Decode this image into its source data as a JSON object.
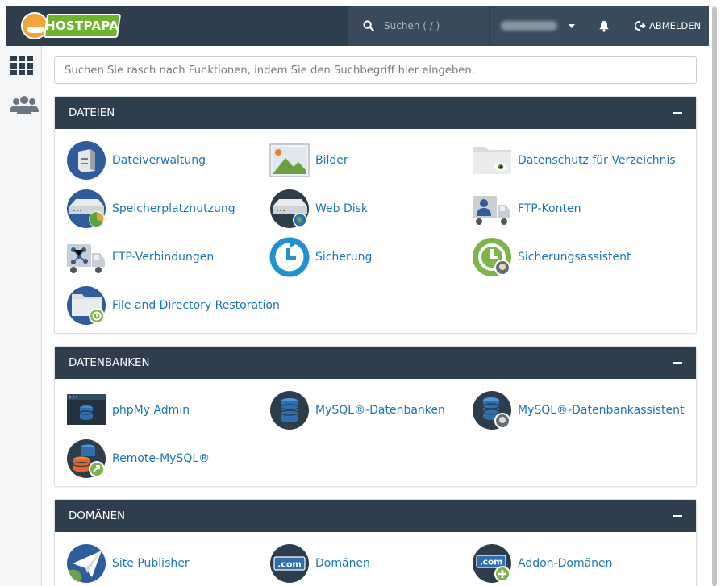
{
  "header": {
    "logo_text": "HOSTPAPA",
    "search_placeholder": "Suchen ( / )",
    "logout_label": "ABMELDEN",
    "colors": {
      "bar": "#2f3e4d",
      "segment": "#394a5b",
      "logo_green": "#6fb42c"
    }
  },
  "sidebar": {
    "items": [
      {
        "name": "apps-grid-icon"
      },
      {
        "name": "users-icon"
      }
    ]
  },
  "main": {
    "search_placeholder": "Suchen Sie rasch nach Funktionen, indem Sie den Suchbegriff hier eingeben.",
    "link_color": "#1b76b6",
    "sections": [
      {
        "title": "DATEIEN",
        "items": [
          {
            "label": "Dateiverwaltung",
            "icon": "file-manager-icon"
          },
          {
            "label": "Bilder",
            "icon": "images-icon"
          },
          {
            "label": "Datenschutz für Verzeichnis",
            "icon": "directory-privacy-icon"
          },
          {
            "label": "Speicherplatznutzung",
            "icon": "disk-usage-icon"
          },
          {
            "label": "Web Disk",
            "icon": "web-disk-icon"
          },
          {
            "label": "FTP-Konten",
            "icon": "ftp-accounts-icon"
          },
          {
            "label": "FTP-Verbindungen",
            "icon": "ftp-connections-icon"
          },
          {
            "label": "Sicherung",
            "icon": "backup-icon"
          },
          {
            "label": "Sicherungsassistent",
            "icon": "backup-wizard-icon"
          },
          {
            "label": "File and Directory Restoration",
            "icon": "file-restoration-icon"
          }
        ]
      },
      {
        "title": "DATENBANKEN",
        "items": [
          {
            "label": "phpMy Admin",
            "icon": "phpmyadmin-icon"
          },
          {
            "label": "MySQL®-Datenbanken",
            "icon": "mysql-databases-icon"
          },
          {
            "label": "MySQL®-Datenbankassistent",
            "icon": "mysql-wizard-icon"
          },
          {
            "label": "Remote-MySQL®",
            "icon": "remote-mysql-icon"
          }
        ]
      },
      {
        "title": "DOMÄNEN",
        "items": [
          {
            "label": "Site Publisher",
            "icon": "site-publisher-icon"
          },
          {
            "label": "Domänen",
            "icon": "domains-icon",
            "icon_text": ".com"
          },
          {
            "label": "Addon-Domänen",
            "icon": "addon-domains-icon",
            "icon_text": ".com"
          }
        ]
      }
    ]
  }
}
